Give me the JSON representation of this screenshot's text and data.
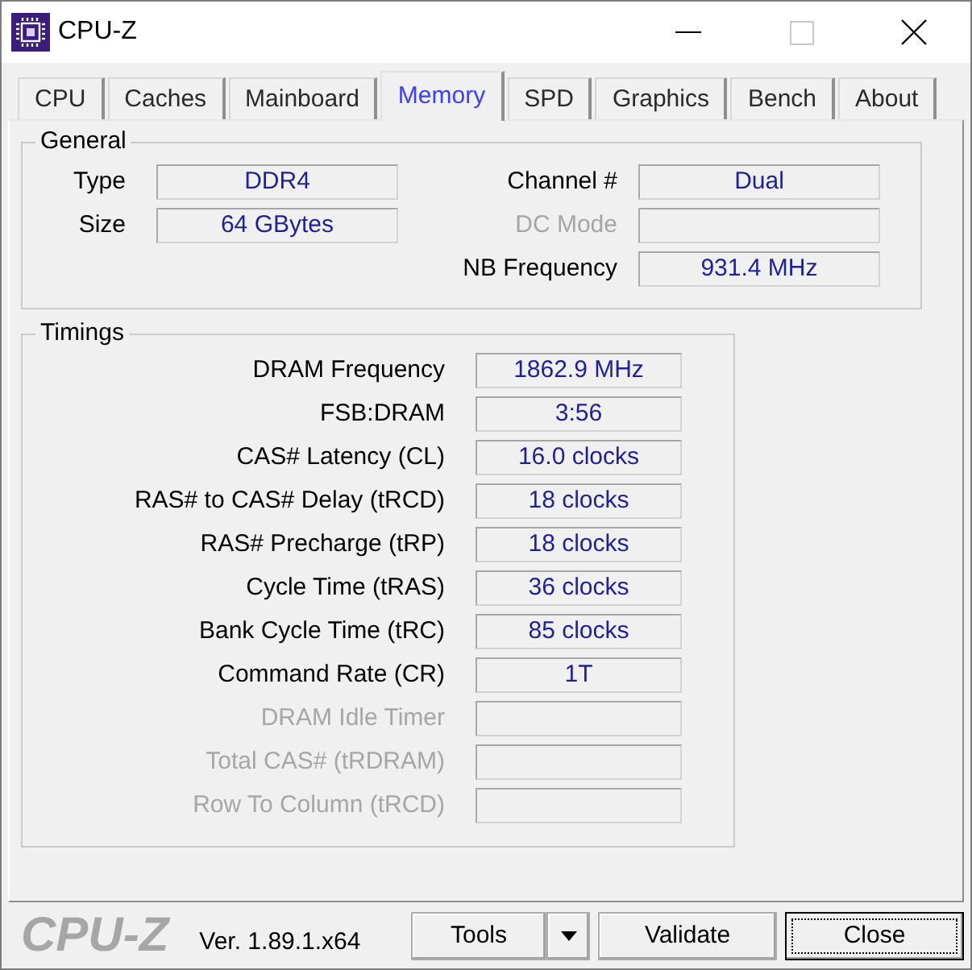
{
  "window": {
    "title": "CPU-Z",
    "controls": [
      {
        "kind": "minimize",
        "disabled": false
      },
      {
        "kind": "maximize",
        "disabled": true
      },
      {
        "kind": "close",
        "disabled": false
      }
    ]
  },
  "tabs": [
    {
      "label": "CPU",
      "selected": false
    },
    {
      "label": "Caches",
      "selected": false
    },
    {
      "label": "Mainboard",
      "selected": false
    },
    {
      "label": "Memory",
      "selected": true
    },
    {
      "label": "SPD",
      "selected": false
    },
    {
      "label": "Graphics",
      "selected": false
    },
    {
      "label": "Bench",
      "selected": false
    },
    {
      "label": "About",
      "selected": false
    }
  ],
  "general": {
    "title": "General",
    "fields_left": [
      {
        "label": "Type",
        "value": "DDR4",
        "disabled": false
      },
      {
        "label": "Size",
        "value": "64 GBytes",
        "disabled": false
      }
    ],
    "fields_right": [
      {
        "label": "Channel #",
        "value": "Dual",
        "disabled": false
      },
      {
        "label": "DC Mode",
        "disabled": true
      },
      {
        "label": "NB Frequency",
        "value": "931.4 MHz",
        "disabled": false
      }
    ]
  },
  "timings": {
    "title": "Timings",
    "fields": [
      {
        "label": "DRAM Frequency",
        "value": "1862.9 MHz",
        "disabled": false
      },
      {
        "label": "FSB:DRAM",
        "value": "3:56",
        "disabled": false
      },
      {
        "label": "CAS# Latency (CL)",
        "value": "16.0 clocks",
        "disabled": false
      },
      {
        "label": "RAS# to CAS# Delay (tRCD)",
        "value": "18 clocks",
        "disabled": false
      },
      {
        "label": "RAS# Precharge (tRP)",
        "value": "18 clocks",
        "disabled": false
      },
      {
        "label": "Cycle Time (tRAS)",
        "value": "36 clocks",
        "disabled": false
      },
      {
        "label": "Bank Cycle Time (tRC)",
        "value": "85 clocks",
        "disabled": false
      },
      {
        "label": "Command Rate (CR)",
        "value": "1T",
        "disabled": false
      },
      {
        "label": "DRAM Idle Timer",
        "disabled": true
      },
      {
        "label": "Total CAS# (tRDRAM)",
        "disabled": true
      },
      {
        "label": "Row To Column (tRCD)",
        "disabled": true
      }
    ]
  },
  "footer": {
    "logo": "CPU-Z",
    "version": "Ver. 1.89.1.x64",
    "buttons": [
      {
        "label": "Tools",
        "kind": "split",
        "focused": false
      },
      {
        "label": "Validate",
        "kind": "plain",
        "focused": false
      },
      {
        "label": "Close",
        "kind": "plain",
        "focused": true
      }
    ]
  }
}
